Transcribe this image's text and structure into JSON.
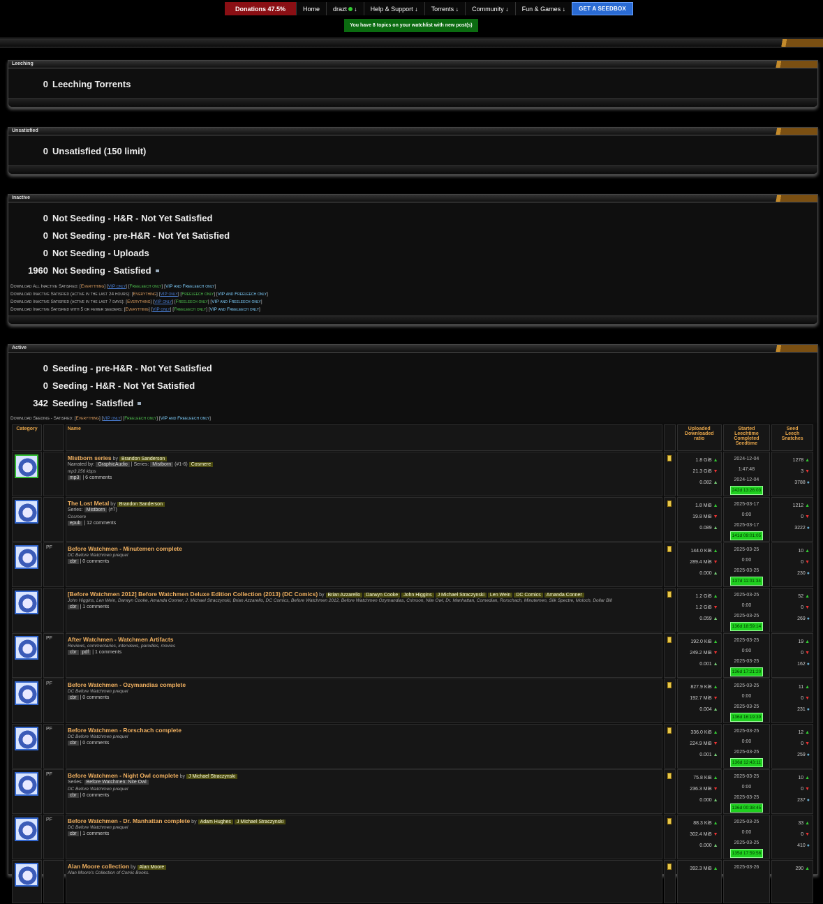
{
  "nav": {
    "donations": "Donations 47.5%",
    "home": "Home",
    "user": "drazt",
    "arrow": "↓",
    "help": "Help & Support ↓",
    "torrents": "Torrents ↓",
    "community": "Community ↓",
    "fun": "Fun & Games ↓",
    "seedbox": "GET A SEEDBOX"
  },
  "watchlist": "You have 8 topics on your watchlist with new post(s)",
  "leeching": {
    "title": "Leeching",
    "rows": [
      {
        "n": "0",
        "label": "Leeching Torrents"
      }
    ]
  },
  "unsatisfied": {
    "title": "Unsatisfied",
    "rows": [
      {
        "n": "0",
        "label": "Unsatisfied (150 limit)"
      }
    ]
  },
  "inactive": {
    "title": "Inactive",
    "rows": [
      {
        "n": "0",
        "label": "Not Seeding - H&R - Not Yet Satisfied"
      },
      {
        "n": "0",
        "label": "Not Seeding - pre-H&R - Not Yet Satisfied"
      },
      {
        "n": "0",
        "label": "Not Seeding - Uploads"
      },
      {
        "n": "1960",
        "label": "Not Seeding - Satisfied"
      }
    ],
    "downloads": [
      "Download All Inactive Satisfied:",
      "Download Inactive Satisfied (active in the last 24 hours):",
      "Download Inactive Satisfied (active in the last 7 days):",
      "Download Inactive Satisfied with 5 or fewer seeders:"
    ]
  },
  "dl_opts": {
    "ev": "Everything",
    "vip": "VIP only",
    "fl": "Freeleech only",
    "vf": "VIP and Freeleech only"
  },
  "active": {
    "title": "Active",
    "rows": [
      {
        "n": "0",
        "label": "Seeding - pre-H&R - Not Yet Satisfied"
      },
      {
        "n": "0",
        "label": "Seeding - H&R - Not Yet Satisfied"
      },
      {
        "n": "342",
        "label": "Seeding - Satisfied"
      }
    ],
    "download": "Download Seeding - Satisfied:"
  },
  "table": {
    "headers": {
      "category": "Category",
      "name": "Name",
      "up": "Uploaded",
      "down": "Downloaded",
      "ratio": "ratio",
      "started": "Started",
      "leechtime": "Leechtime",
      "completed": "Completed",
      "seedtime": "Seedtime",
      "seed": "Seed",
      "leech": "Leech",
      "snatches": "Snatches"
    },
    "rows": [
      {
        "flag": "",
        "title": "Mistborn series",
        "by": "by",
        "authors": [
          "Brandon Sanderson"
        ],
        "line2": "Narrated by:",
        "narrator": "GraphicAudio",
        "series_label": "| Series:",
        "series": "Mistborn",
        "series_extra": "(#1-6)",
        "extra_tag": "Cosmere",
        "italic": "mp3 256 kbps",
        "formats": [
          "mp3"
        ],
        "comments": "| 6 comments",
        "up": "1.8 GiB",
        "down": "21.3 GiB",
        "ratio": "0.082",
        "started": "2024-12-04",
        "leech": "1:47:48",
        "completed": "2024-12-04",
        "seedtime": "242d 13:26:03",
        "seeders": "1278",
        "leechers": "3",
        "snatches": "3788"
      },
      {
        "flag": "",
        "title": "The Lost Metal",
        "by": "by",
        "authors": [
          "Brandon Sanderson"
        ],
        "line2": "Series:",
        "series": "Mistborn",
        "series_extra": "(#7)",
        "italic": "Cosmere",
        "formats": [
          "epub"
        ],
        "comments": "| 12 comments",
        "up": "1.8 MiB",
        "down": "19.8 MiB",
        "ratio": "0.089",
        "started": "2025-03-17",
        "leech": "0:00",
        "completed": "2025-03-17",
        "seedtime": "141d 09:01:05",
        "seeders": "1212",
        "leechers": "0",
        "snatches": "3222"
      },
      {
        "flag": "PF",
        "title": "Before Watchmen - Minutemen complete",
        "italic": "DC Before Watchmen prequel",
        "formats": [
          "cbr"
        ],
        "comments": "| 0 comments",
        "up": "144.0 KiB",
        "down": "289.4 MiB",
        "ratio": "0.000",
        "started": "2025-03-25",
        "leech": "0:00",
        "completed": "2025-03-25",
        "seedtime": "137d 11:01:34",
        "seeders": "10",
        "leechers": "0",
        "snatches": "230"
      },
      {
        "flag": "",
        "title": "[Before Watchmen 2012] Before Watchmen Deluxe Edition Collection (2013) (DC Comics)",
        "by": "by",
        "authors": [
          "Brian Azzarello",
          "Darwyn Cooke",
          "John Higgins",
          "J Michael Straczynski",
          "Len Wein",
          "DC Comics",
          "Amanda Conner"
        ],
        "italic": "John Higgins, Len Wein, Darwyn Cooke, Amanda Conner, J. Michael Straczynski, Brian Azzarello, DC Comics, Before Watchmen 2012, Before Watchmen Ozymandias, Crimson, Nite Owl, Dr. Manhattan, Comedian, Rorschach, Minutemen, Silk Spectre, Moloch, Dollar Bill",
        "formats": [
          "cbr"
        ],
        "comments": "| 1 comments",
        "up": "1.2 GiB",
        "down": "1.2 GiB",
        "ratio": "0.059",
        "started": "2025-03-25",
        "leech": "0:00",
        "completed": "2025-03-25",
        "seedtime": "136d 18:59:14",
        "seeders": "52",
        "leechers": "0",
        "snatches": "269"
      },
      {
        "flag": "PF",
        "title": "After Watchmen - Watchmen Artifacts",
        "italic": "Reviews, commentaries, interviews, parodies, movies",
        "formats": [
          "cbr",
          "pdf"
        ],
        "comments": "| 1 comments",
        "up": "192.0 KiB",
        "down": "249.2 MiB",
        "ratio": "0.001",
        "started": "2025-03-25",
        "leech": "0:00",
        "completed": "2025-03-25",
        "seedtime": "136d 17:21:20",
        "seeders": "19",
        "leechers": "0",
        "snatches": "162"
      },
      {
        "flag": "PF",
        "title": "Before Watchmen - Ozymandias complete",
        "italic": "DC Before Watchmen prequel",
        "formats": [
          "cbr"
        ],
        "comments": "| 0 comments",
        "up": "827.9 KiB",
        "down": "192.7 MiB",
        "ratio": "0.004",
        "started": "2025-03-25",
        "leech": "0:00",
        "completed": "2025-03-25",
        "seedtime": "136d 16:19:39",
        "seeders": "11",
        "leechers": "0",
        "snatches": "231"
      },
      {
        "flag": "PF",
        "title": "Before Watchmen - Rorschach complete",
        "italic": "DC Before Watchmen prequel",
        "formats": [
          "cbr"
        ],
        "comments": "| 0 comments",
        "up": "336.0 KiB",
        "down": "224.9 MiB",
        "ratio": "0.001",
        "started": "2025-03-25",
        "leech": "0:00",
        "completed": "2025-03-25",
        "seedtime": "136d 12:43:11",
        "seeders": "12",
        "leechers": "0",
        "snatches": "259"
      },
      {
        "flag": "PF",
        "title": "Before Watchmen - Night Owl complete",
        "by": "by",
        "authors": [
          "J Michael Straczynski"
        ],
        "line2": "Series:",
        "series": "Before Watchmen: Nite Owl",
        "italic": "DC Before Watchmen prequel",
        "formats": [
          "cbr"
        ],
        "comments": "| 0 comments",
        "up": "75.8 KiB",
        "down": "236.3 MiB",
        "ratio": "0.000",
        "started": "2025-03-25",
        "leech": "0:00",
        "completed": "2025-03-25",
        "seedtime": "136d 00:38:45",
        "seeders": "10",
        "leechers": "0",
        "snatches": "237"
      },
      {
        "flag": "PF",
        "title": "Before Watchmen - Dr. Manhattan complete",
        "by": "by",
        "authors": [
          "Adam Hughes",
          "J Michael Straczynski"
        ],
        "italic": "DC Before Watchmen prequel",
        "formats": [
          "cbr"
        ],
        "comments": "| 1 comments",
        "up": "88.3 KiB",
        "down": "302.4 MiB",
        "ratio": "0.000",
        "started": "2025-03-25",
        "leech": "0:00",
        "completed": "2025-03-25",
        "seedtime": "135d 17:59:56",
        "seeders": "33",
        "leechers": "0",
        "snatches": "410"
      },
      {
        "flag": "",
        "title": "Alan Moore collection",
        "by": "by",
        "authors": [
          "Alan Moore"
        ],
        "italic": "Alan Moore's Collection of Comic Books.",
        "formats": [],
        "comments": "",
        "up": "392.3 MiB",
        "down": "",
        "ratio": "",
        "started": "2025-03-26",
        "leech": "",
        "completed": "",
        "seedtime": "",
        "seeders": "290",
        "leechers": "",
        "snatches": ""
      }
    ]
  }
}
